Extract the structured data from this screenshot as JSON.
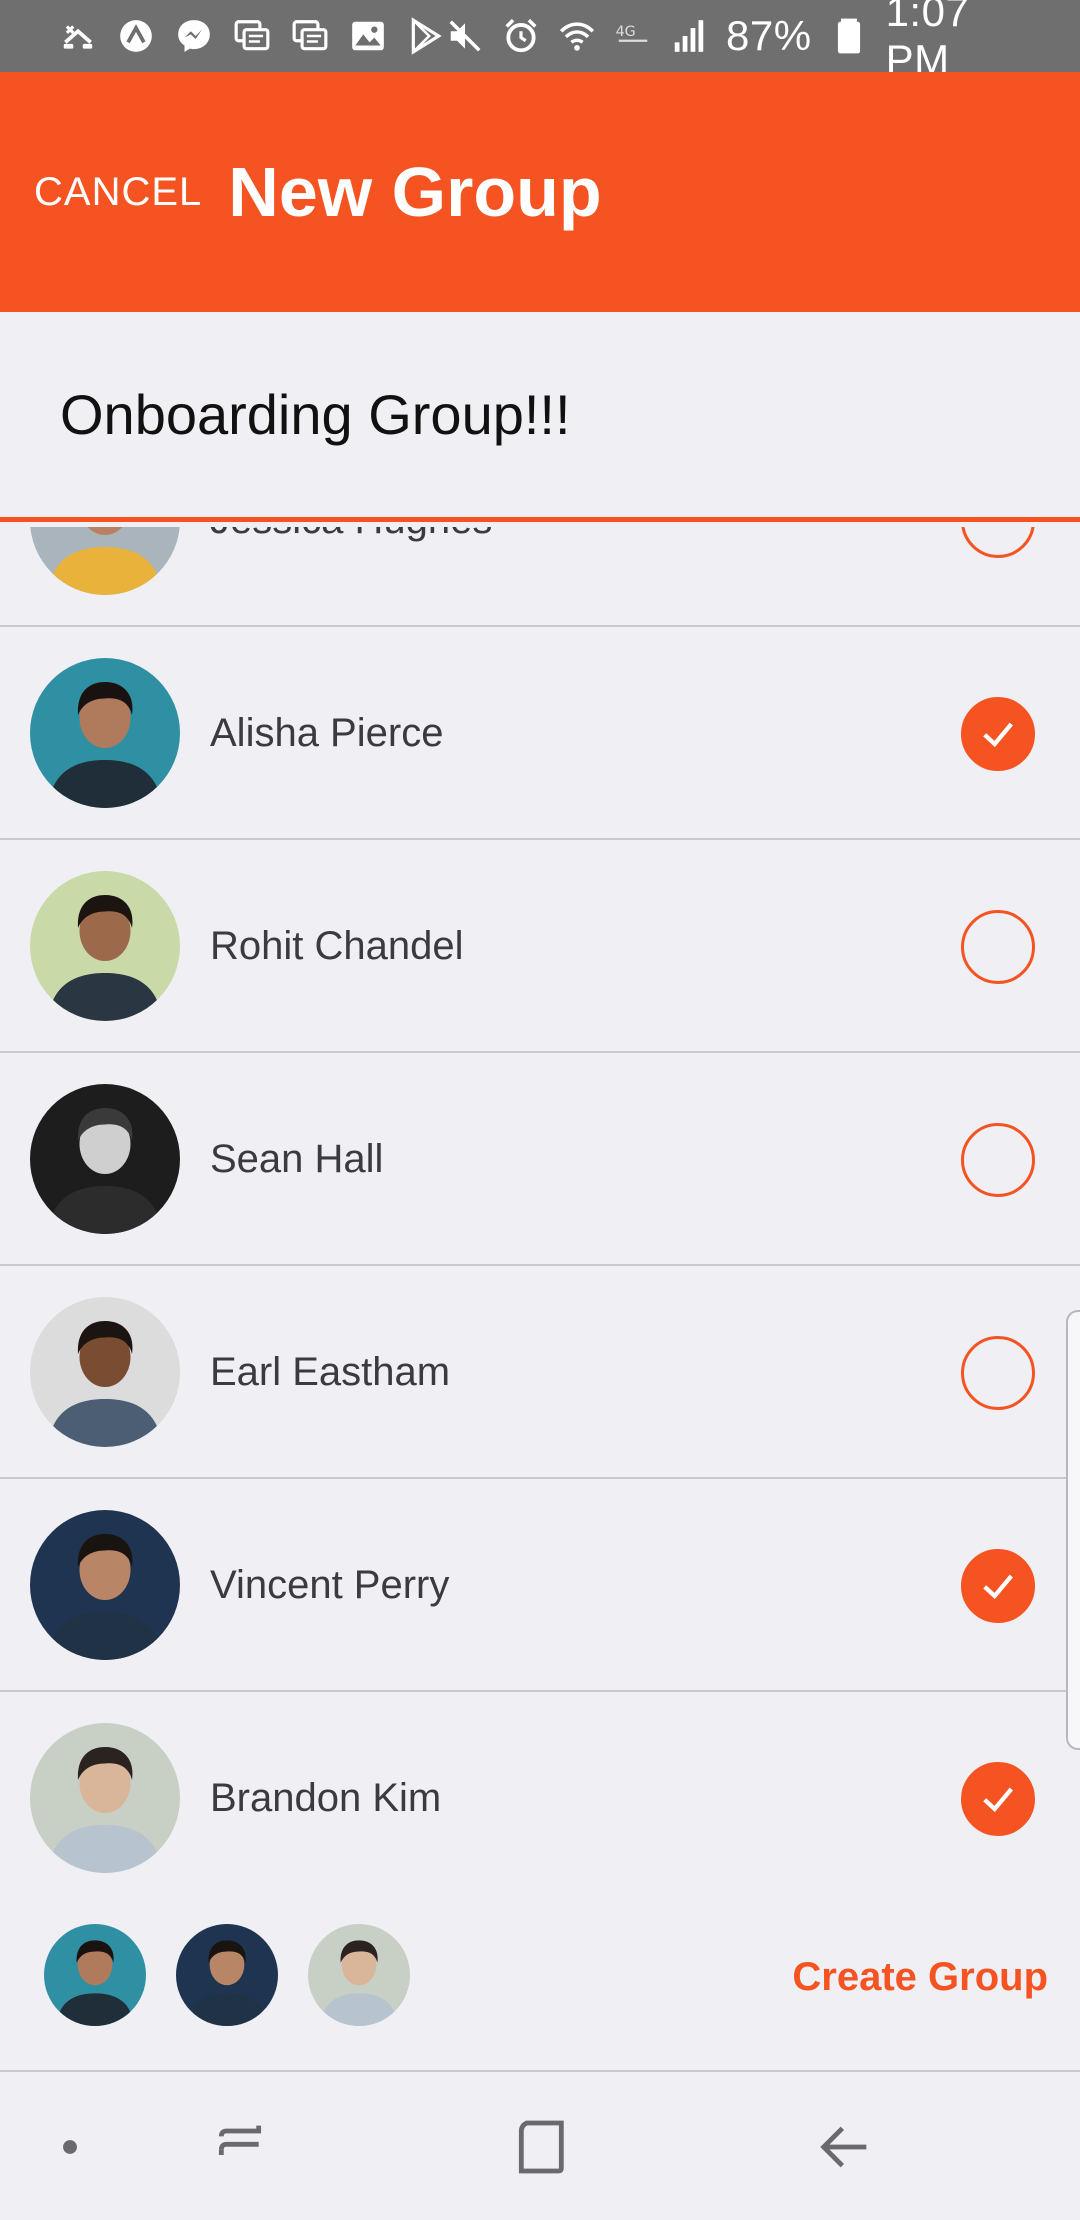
{
  "status_bar": {
    "battery": "87%",
    "time": "1:07 PM",
    "left_icons": [
      "missed-call-icon",
      "app-icon",
      "messenger-icon",
      "message-icon",
      "message-icon",
      "gallery-icon",
      "play-store-icon"
    ],
    "right_icons": [
      "mute-icon",
      "alarm-icon",
      "wifi-icon",
      "lte-icon",
      "signal-icon",
      "battery-icon"
    ]
  },
  "header": {
    "cancel_label": "CANCEL",
    "title": "New Group"
  },
  "group_name": {
    "value": "Onboarding Group!!!"
  },
  "contacts": [
    {
      "name": "Jessica Hughes",
      "selected": false,
      "avatar_bg": "#a9b4bd",
      "skin": "#b98163",
      "shirt": "#e8b23b",
      "hair": "#2b1d16"
    },
    {
      "name": "Alisha Pierce",
      "selected": true,
      "avatar_bg": "#2f8fa3",
      "skin": "#b07a5c",
      "shirt": "#1f2e38",
      "hair": "#1a1210"
    },
    {
      "name": "Rohit Chandel",
      "selected": false,
      "avatar_bg": "#c9d9a8",
      "skin": "#9c6a4a",
      "shirt": "#2a3642",
      "hair": "#1b1411"
    },
    {
      "name": "Sean Hall",
      "selected": false,
      "avatar_bg": "#1d1d1d",
      "skin": "#cfcfcf",
      "shirt": "#2c2c2c",
      "hair": "#3a3a3a"
    },
    {
      "name": "Earl Eastham",
      "selected": false,
      "avatar_bg": "#dcdcdc",
      "skin": "#7a4d33",
      "shirt": "#4b5e73",
      "hair": "#1c1410"
    },
    {
      "name": "Vincent Perry",
      "selected": true,
      "avatar_bg": "#1e3450",
      "skin": "#b88566",
      "shirt": "#203246",
      "hair": "#1a1410"
    },
    {
      "name": "Brandon Kim",
      "selected": true,
      "avatar_bg": "#c8cfc4",
      "skin": "#d9b59a",
      "shirt": "#b7c3cf",
      "hair": "#2a2320"
    }
  ],
  "selected": [
    "Alisha Pierce",
    "Vincent Perry",
    "Brandon Kim"
  ],
  "footer": {
    "create_label": "Create Group"
  },
  "nav": {
    "items": [
      "dot-icon",
      "recent-apps-icon",
      "home-icon",
      "back-icon"
    ]
  },
  "colors": {
    "accent": "#f55321",
    "background": "#efeff4",
    "status_bar": "#6f6f6f"
  }
}
